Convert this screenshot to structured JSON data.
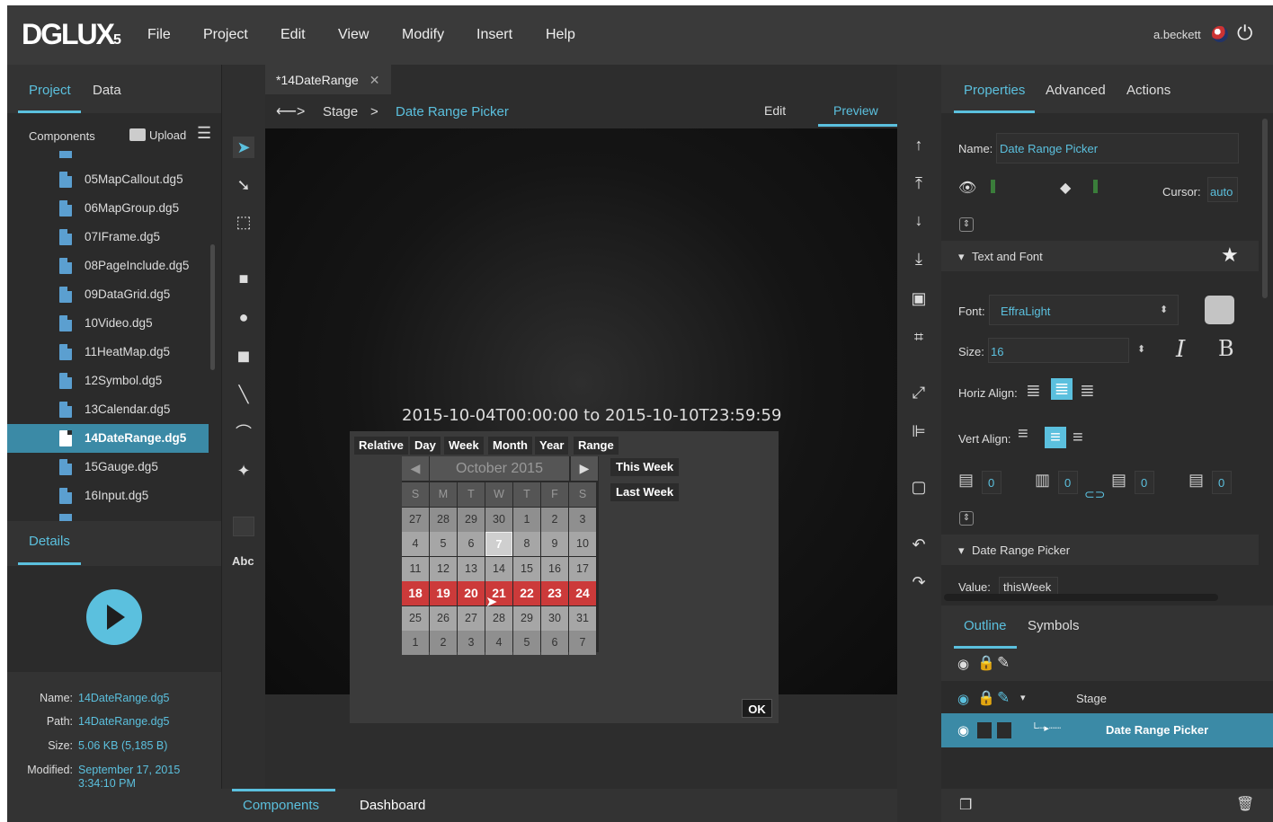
{
  "app": {
    "logo": "DGLUX",
    "logo_suffix": "5",
    "menu": [
      "File",
      "Project",
      "Edit",
      "View",
      "Modify",
      "Insert",
      "Help"
    ],
    "user": "a.beckett"
  },
  "left": {
    "tabs": [
      "Project",
      "Data"
    ],
    "components_label": "Components",
    "upload_label": "Upload",
    "files": [
      "05MapCallout.dg5",
      "06MapGroup.dg5",
      "07IFrame.dg5",
      "08PageInclude.dg5",
      "09DataGrid.dg5",
      "10Video.dg5",
      "11HeatMap.dg5",
      "12Symbol.dg5",
      "13Calendar.dg5",
      "14DateRange.dg5",
      "15Gauge.dg5",
      "16Input.dg5"
    ],
    "selected_file": "14DateRange.dg5",
    "details_tab": "Details",
    "details": {
      "name_label": "Name:",
      "name": "14DateRange.dg5",
      "path_label": "Path:",
      "path": "14DateRange.dg5",
      "size_label": "Size:",
      "size": "5.06 KB (5,185 B)",
      "modified_label": "Modified:",
      "modified_line1": "September 17, 2015",
      "modified_line2": "3:34:10 PM"
    }
  },
  "tools": {
    "text_tool": "Abc"
  },
  "center": {
    "doc_tab": "*14DateRange",
    "breadcrumb": [
      "Stage",
      "Date Range Picker"
    ],
    "breadcrumb_sep": ">",
    "mode_edit": "Edit",
    "mode_preview": "Preview",
    "range_text": "2015-10-04T00:00:00 to 2015-10-10T23:59:59",
    "picker_buttons": [
      "Relative",
      "Day",
      "Week",
      "Month",
      "Year",
      "Range"
    ],
    "month_label": "October 2015",
    "weekdays": [
      "S",
      "M",
      "T",
      "W",
      "T",
      "F",
      "S"
    ],
    "weeks": [
      [
        "27",
        "28",
        "29",
        "30",
        "1",
        "2",
        "3"
      ],
      [
        "4",
        "5",
        "6",
        "7",
        "8",
        "9",
        "10"
      ],
      [
        "11",
        "12",
        "13",
        "14",
        "15",
        "16",
        "17"
      ],
      [
        "18",
        "19",
        "20",
        "21",
        "22",
        "23",
        "24"
      ],
      [
        "25",
        "26",
        "27",
        "28",
        "29",
        "30",
        "31"
      ],
      [
        "1",
        "2",
        "3",
        "4",
        "5",
        "6",
        "7"
      ]
    ],
    "today": "7",
    "selected_range": [
      "18",
      "19",
      "20",
      "21",
      "22",
      "23",
      "24"
    ],
    "quick_buttons": [
      "This Week",
      "Last Week"
    ],
    "ok_label": "OK",
    "bottom_tabs": [
      "Components",
      "Dashboard"
    ]
  },
  "right": {
    "tabs": [
      "Properties",
      "Advanced",
      "Actions"
    ],
    "name_label": "Name:",
    "name_value": "Date Range Picker",
    "cursor_label": "Cursor:",
    "cursor_value": "auto",
    "text_font_section": "Text and Font",
    "font_label": "Font:",
    "font_value": "EffraLight",
    "size_label": "Size:",
    "size_value": "16",
    "horiz_align_label": "Horiz Align:",
    "vert_align_label": "Vert Align:",
    "padding_values": [
      "0",
      "0",
      "0",
      "0"
    ],
    "drp_section": "Date Range Picker",
    "value_label": "Value:",
    "value_value": "thisWeek",
    "outline_tabs": [
      "Outline",
      "Symbols"
    ],
    "outline_items": [
      "Stage",
      "Date Range Picker"
    ]
  },
  "colors": {
    "accent": "#5bc0de",
    "range": "#cc3a3a",
    "selection": "#3b8aa6"
  }
}
